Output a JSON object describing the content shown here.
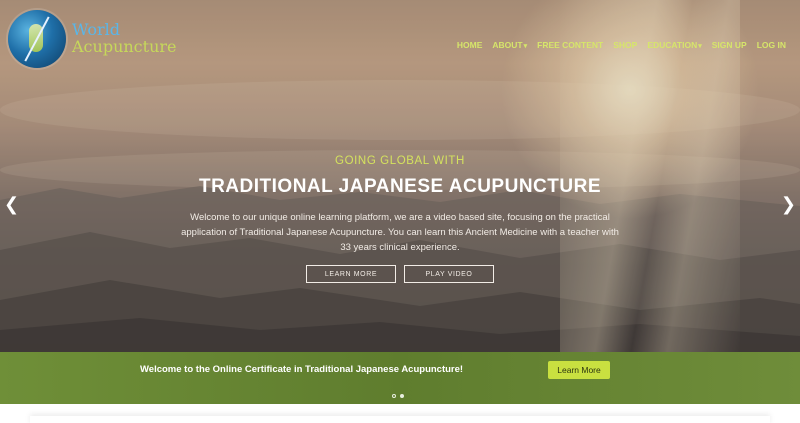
{
  "brand": {
    "line1": "World",
    "line2": "Acupuncture",
    "logo_icon": "yin-yang-needle-icon"
  },
  "nav": {
    "home": "HOME",
    "about": "ABOUT",
    "free_content": "FREE CONTENT",
    "shop": "SHOP",
    "education": "EDUCATION",
    "sign_up": "SIGN UP",
    "log_in": "LOG IN",
    "dropdown_icon": "caret-down-icon"
  },
  "hero": {
    "eyebrow": "GOING GLOBAL WITH",
    "headline": "TRADITIONAL JAPANESE ACUPUNCTURE",
    "description": "Welcome to our unique online learning platform, we are a video based site, focusing on the practical application of Traditional Japanese Acupuncture. You can learn this Ancient Medicine with a teacher with 33 years clinical experience.",
    "learn_more": "LEARN MORE",
    "play_video": "PLAY VIDEO",
    "prev_icon": "chevron-left-icon",
    "next_icon": "chevron-right-icon"
  },
  "banner": {
    "text": "Welcome to the Online Certificate in Traditional Japanese Acupuncture!",
    "button": "Learn More"
  },
  "carousel": {
    "slide_count": 2,
    "active_index": 1
  },
  "colors": {
    "accent": "#d6e66a",
    "brand_blue": "#5ab6e8",
    "banner_green": "#6f8f38",
    "button_lime": "#c9e040"
  }
}
